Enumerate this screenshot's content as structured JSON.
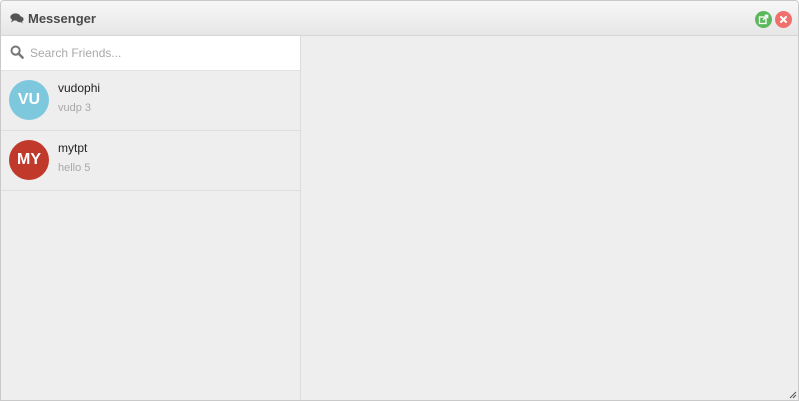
{
  "window": {
    "title": "Messenger",
    "title_icon": "comments-icon",
    "popout_icon": "external-link-icon",
    "close_icon": "close-icon"
  },
  "search": {
    "placeholder": "Search Friends...",
    "value": "",
    "icon": "search-icon"
  },
  "contacts": [
    {
      "initials": "VU",
      "name": "vudophi",
      "last_message": "vudp 3",
      "avatar_color": "#7ec8de"
    },
    {
      "initials": "MY",
      "name": "mytpt",
      "last_message": "hello 5",
      "avatar_color": "#c0392b"
    }
  ],
  "colors": {
    "popout_button": "#5cb85c",
    "close_button": "#f0716c",
    "window_bg": "#eeeeee"
  }
}
